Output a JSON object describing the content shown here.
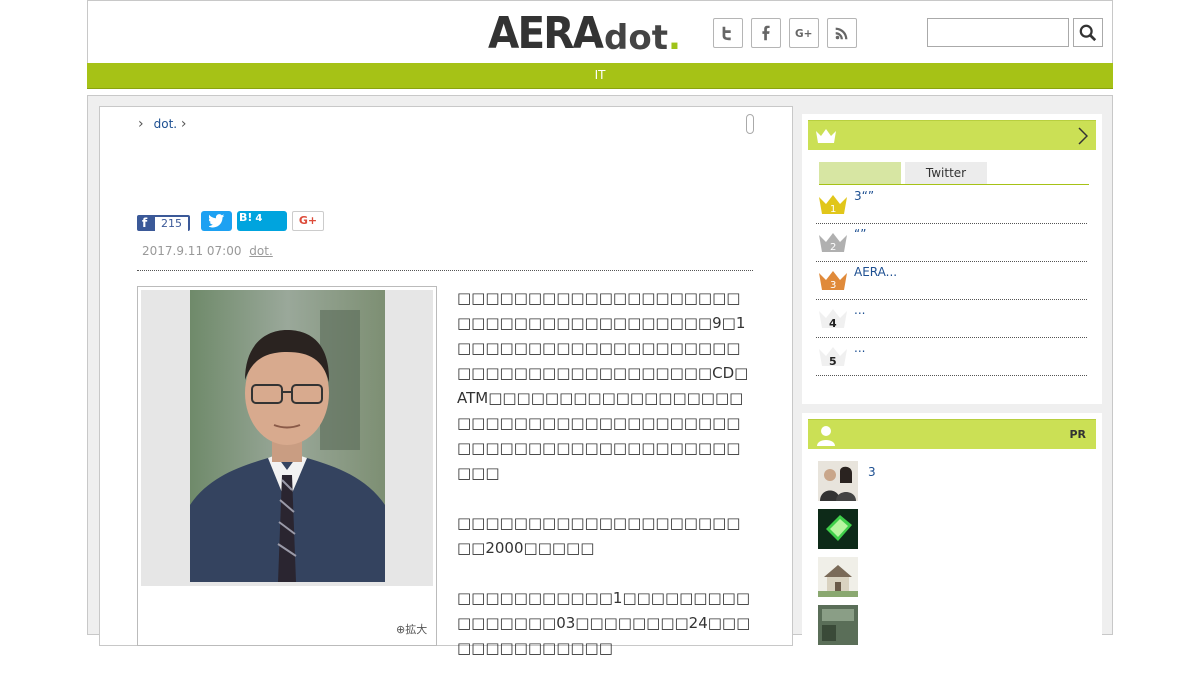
{
  "header": {
    "logo_main": "AERA",
    "logo_dot": "dot",
    "logo_period": ".",
    "social": [
      "twitter-icon",
      "facebook-icon",
      "googleplus-icon",
      "rss-icon"
    ],
    "search_placeholder": ""
  },
  "nav": {
    "label": "IT"
  },
  "breadcrumb": {
    "item": "dot."
  },
  "share": {
    "facebook_count": "215",
    "hatena_label": "B!",
    "hatena_count": "4",
    "gplus_label": "G+"
  },
  "article": {
    "date": "2017.9.11 07:00",
    "source": "dot.",
    "enlarge_label": "拡大",
    "paragraphs": [
      "□□□□□□□□□□□□□□□□□□□□□□□□□□□□□□□□□□□□□□9□1□□□□□□□□□□□□□□□□□□□□□□□□□□□□□□□□□□□□□□CD□ATM□□□□□□□□□□□□□□□□□□□□□□□□□□□□□□□□□□□□□□□□□□□□□□□□□□□□□□□□□□□□□",
      "□□□□□□□□□□□□□□□□□□□□□□2000□□□□□",
      "□□□□□□□□□□□1□□□□□□□□□□□□□□□□03□□□□□□□□24□□□□□□□□□□□□□□"
    ]
  },
  "sidebar": {
    "ranking": {
      "tabs": [
        "",
        "Twitter"
      ],
      "items": [
        {
          "rank": "1",
          "text": "3“”"
        },
        {
          "rank": "2",
          "text": "“”"
        },
        {
          "rank": "3",
          "text": "AERA..."
        },
        {
          "rank": "4",
          "text": "..."
        },
        {
          "rank": "5",
          "text": "..."
        }
      ]
    },
    "pr": {
      "label": "PR",
      "items": [
        {
          "text": "3"
        },
        {
          "text": ""
        },
        {
          "text": ""
        },
        {
          "text": ""
        }
      ]
    }
  },
  "colors": {
    "brand_green": "#a6c216",
    "header_green": "#cbe055",
    "facebook": "#3b5998",
    "twitter": "#1da1f2",
    "hatena": "#00a4de",
    "gold": "#e1c61a",
    "silver": "#b0b0b0",
    "bronze": "#e08a3a"
  }
}
